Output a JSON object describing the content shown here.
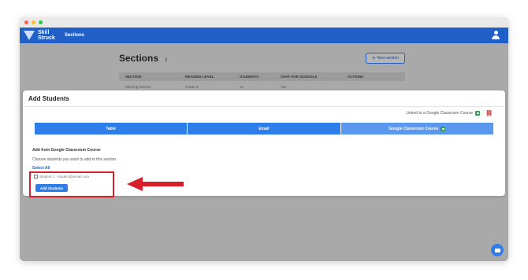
{
  "navbar": {
    "logo_text": "Skill Struck",
    "nav_link": "Sections"
  },
  "sections_page": {
    "title": "Sections",
    "count": "2",
    "new_section_label": "New section",
    "table_headers": [
      "SECTION",
      "READING LEVEL",
      "STUDENTS",
      "CHAT FOR SCHOOLS",
      "ACTIONS"
    ],
    "peek_row": [
      "Morning Section",
      "Grade 3",
      "12",
      "Yes"
    ]
  },
  "modal": {
    "title": "Add Students",
    "linked_text": "Linked to a Google Classroom Course",
    "tabs": [
      "Table",
      "Email",
      "Google Classroom Course"
    ],
    "section_label": "Add from Google Classroom Course",
    "section_help": "Choose students you want to add to this section",
    "select_all": "Select All",
    "students": [
      {
        "label": "Student 1 - student@email.com"
      }
    ],
    "add_button": "Add Students"
  },
  "colors": {
    "brand_blue": "#1f5fc7",
    "tab_blue": "#2f7de9",
    "highlight_red": "#d61f2b"
  }
}
